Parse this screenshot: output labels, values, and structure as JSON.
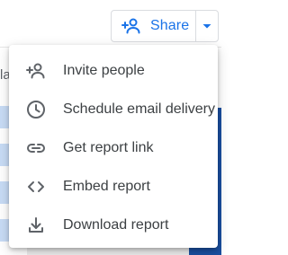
{
  "share": {
    "label": "Share",
    "icon": "person-add-icon",
    "dropdown_icon": "caret-down-icon",
    "accent_color": "#1a73e8"
  },
  "background": {
    "toolbar_fragment": "la"
  },
  "menu": {
    "items": [
      {
        "label": "Invite people",
        "icon": "person-add-icon"
      },
      {
        "label": "Schedule email delivery",
        "icon": "clock-icon"
      },
      {
        "label": "Get report link",
        "icon": "link-icon"
      },
      {
        "label": "Embed report",
        "icon": "code-icon"
      },
      {
        "label": "Download report",
        "icon": "download-icon"
      }
    ]
  }
}
